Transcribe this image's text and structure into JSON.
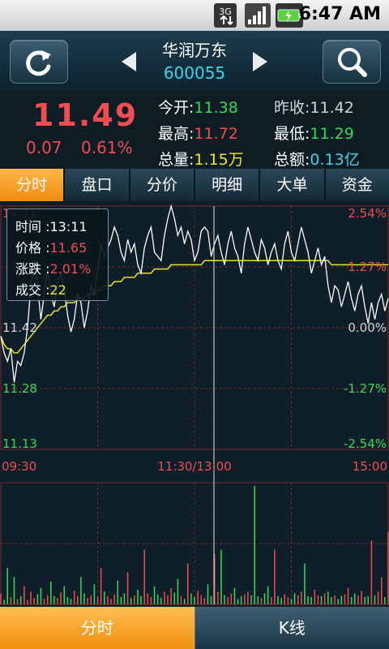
{
  "status_bar": {
    "time": "6:47 AM",
    "network": "3G"
  },
  "header": {
    "stock_name": "华润万东",
    "stock_code": "600055"
  },
  "quote": {
    "price": "11.49",
    "change": "0.07",
    "change_pct": "0.61%",
    "open_label": "今开:",
    "open": "11.38",
    "prev_close_label": "昨收:",
    "prev_close": "11.42",
    "high_label": "最高:",
    "high": "11.72",
    "low_label": "最低:",
    "low": "11.29",
    "volume_label": "总量:",
    "volume": "1.15万",
    "amount_label": "总额:",
    "amount": "0.13亿"
  },
  "tabs": [
    "分时",
    "盘口",
    "分价",
    "明细",
    "大单",
    "资金"
  ],
  "chart_data": {
    "type": "line",
    "price_axis": [
      "11.71",
      "11.42",
      "11.28",
      "11.13"
    ],
    "pct_axis": [
      "2.54%",
      "1.27%",
      "0.00%",
      "-1.27%",
      "-2.54%"
    ],
    "time_axis": [
      "09:30",
      "11:30/13:00",
      "15:00"
    ],
    "ylim": [
      11.13,
      11.71
    ],
    "prev_close": 11.42,
    "price": [
      11.4,
      11.36,
      11.34,
      11.37,
      11.29,
      11.34,
      11.33,
      11.36,
      11.42,
      11.52,
      11.58,
      11.52,
      11.44,
      11.5,
      11.56,
      11.5,
      11.47,
      11.53,
      11.55,
      11.51,
      11.45,
      11.41,
      11.44,
      11.5,
      11.48,
      11.42,
      11.46,
      11.52,
      11.5,
      11.56,
      11.62,
      11.59,
      11.61,
      11.63,
      11.66,
      11.64,
      11.6,
      11.58,
      11.63,
      11.6,
      11.62,
      11.57,
      11.55,
      11.61,
      11.64,
      11.66,
      11.6,
      11.59,
      11.58,
      11.64,
      11.68,
      11.71,
      11.68,
      11.64,
      11.66,
      11.62,
      11.65,
      11.63,
      11.58,
      11.6,
      11.65,
      11.66,
      11.65,
      11.59,
      11.62,
      11.64,
      11.6,
      11.57,
      11.62,
      11.65,
      11.61,
      11.59,
      11.55,
      11.62,
      11.66,
      11.63,
      11.6,
      11.58,
      11.63,
      11.61,
      11.57,
      11.6,
      11.62,
      11.58,
      11.56,
      11.62,
      11.65,
      11.6,
      11.58,
      11.62,
      11.66,
      11.63,
      11.6,
      11.55,
      11.58,
      11.61,
      11.57,
      11.59,
      11.52,
      11.48,
      11.52,
      11.51,
      11.47,
      11.5,
      11.53,
      11.49,
      11.46,
      11.5,
      11.52,
      11.47,
      11.43,
      11.48,
      11.44,
      11.48,
      11.5,
      11.46,
      11.49
    ],
    "avg_price": [
      11.4,
      11.38,
      11.37,
      11.37,
      11.36,
      11.36,
      11.37,
      11.38,
      11.39,
      11.4,
      11.41,
      11.42,
      11.43,
      11.44,
      11.45,
      11.45,
      11.46,
      11.46,
      11.47,
      11.47,
      11.48,
      11.48,
      11.48,
      11.49,
      11.49,
      11.49,
      11.5,
      11.5,
      11.5,
      11.51,
      11.51,
      11.52,
      11.52,
      11.52,
      11.53,
      11.53,
      11.53,
      11.54,
      11.54,
      11.54,
      11.54,
      11.55,
      11.55,
      11.55,
      11.55,
      11.55,
      11.56,
      11.56,
      11.56,
      11.56,
      11.56,
      11.57,
      11.57,
      11.57,
      11.57,
      11.57,
      11.57,
      11.57,
      11.57,
      11.57,
      11.57,
      11.58,
      11.58,
      11.58,
      11.58,
      11.58,
      11.58,
      11.58,
      11.58,
      11.58,
      11.58,
      11.58,
      11.58,
      11.58,
      11.58,
      11.58,
      11.58,
      11.58,
      11.58,
      11.58,
      11.58,
      11.58,
      11.58,
      11.58,
      11.58,
      11.58,
      11.58,
      11.58,
      11.58,
      11.58,
      11.58,
      11.58,
      11.58,
      11.58,
      11.58,
      11.58,
      11.58,
      11.58,
      11.58,
      11.57,
      11.57,
      11.57,
      11.57,
      11.57,
      11.57,
      11.57,
      11.57,
      11.57,
      11.57,
      11.57,
      11.57,
      11.57,
      11.57,
      11.57,
      11.57,
      11.57,
      11.57
    ],
    "volume": [
      12,
      5,
      40,
      8,
      30,
      6,
      9,
      20,
      5,
      14,
      7,
      11,
      18,
      6,
      10,
      25,
      9,
      7,
      13,
      20,
      8,
      6,
      15,
      9,
      30,
      12,
      7,
      10,
      22,
      8,
      40,
      14,
      9,
      6,
      11,
      26,
      8,
      12,
      35,
      7,
      10,
      16,
      9,
      60,
      12,
      8,
      20,
      11,
      7,
      14,
      10,
      18,
      13,
      28,
      9,
      6,
      45,
      12,
      8,
      15,
      10,
      7,
      22,
      9,
      55,
      14,
      60,
      10,
      8,
      12,
      18,
      6,
      9,
      11,
      14,
      10,
      130,
      9,
      7,
      12,
      20,
      8,
      60,
      9,
      7,
      11,
      8,
      6,
      12,
      10,
      14,
      45,
      9,
      8,
      16,
      10,
      9,
      12,
      14,
      8,
      10,
      6,
      9,
      11,
      18,
      8,
      12,
      10,
      15,
      8,
      9,
      70,
      10,
      14,
      30,
      8,
      80
    ]
  },
  "tooltip": {
    "time_label": "时间 :",
    "time": "13:11",
    "price_label": "价格 :",
    "price": "11.65",
    "change_label": "涨跌 :",
    "change": "2.01%",
    "volume_label": "成交 :",
    "volume": "22"
  },
  "bottom_nav": {
    "left": "分时",
    "right": "K线"
  },
  "colors": {
    "up": "#ef4d52",
    "down": "#37d85a",
    "accent": "#f39a1f",
    "avg_line": "#e6e03a",
    "grid": "#7a2a2a"
  }
}
